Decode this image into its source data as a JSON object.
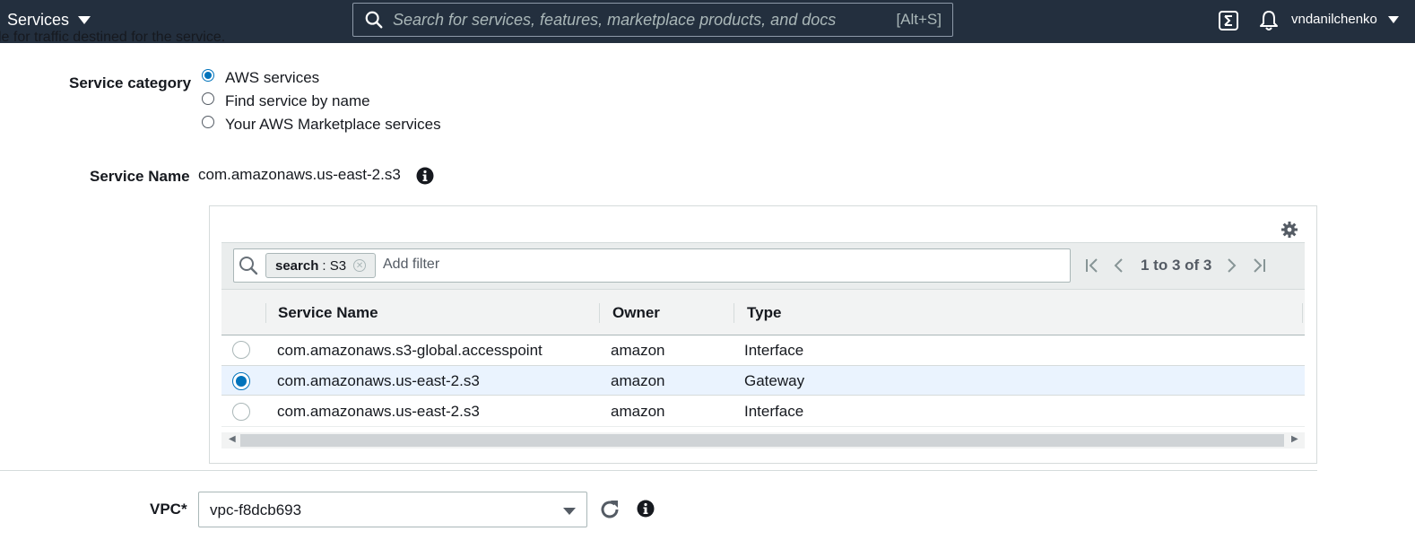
{
  "topnav": {
    "services_label": "Services",
    "search_placeholder": "Search for services, features, marketplace products, and docs",
    "search_shortcut": "[Alt+S]",
    "username": "vndanilchenko"
  },
  "cutoff_text": "le for traffic destined for the service.",
  "service_category": {
    "label": "Service category",
    "options": [
      {
        "label": "AWS services",
        "checked": true
      },
      {
        "label": "Find service by name",
        "checked": false
      },
      {
        "label": "Your AWS Marketplace services",
        "checked": false
      }
    ]
  },
  "service_name": {
    "label": "Service Name",
    "value": "com.amazonaws.us-east-2.s3"
  },
  "table": {
    "filter_token_key": "search",
    "filter_token_value": ": S3",
    "filter_placeholder": "Add filter",
    "pagination": "1 to 3 of 3",
    "columns": [
      "Service Name",
      "Owner",
      "Type"
    ],
    "rows": [
      {
        "service": "com.amazonaws.s3-global.accesspoint",
        "owner": "amazon",
        "type": "Interface",
        "selected": false
      },
      {
        "service": "com.amazonaws.us-east-2.s3",
        "owner": "amazon",
        "type": "Gateway",
        "selected": true
      },
      {
        "service": "com.amazonaws.us-east-2.s3",
        "owner": "amazon",
        "type": "Interface",
        "selected": false
      }
    ]
  },
  "vpc": {
    "label": "VPC*",
    "value": "vpc-f8dcb693"
  },
  "colors": {
    "nav_bg": "#232f3e",
    "accent": "#0073bb",
    "selected_row": "#eaf3fe"
  }
}
